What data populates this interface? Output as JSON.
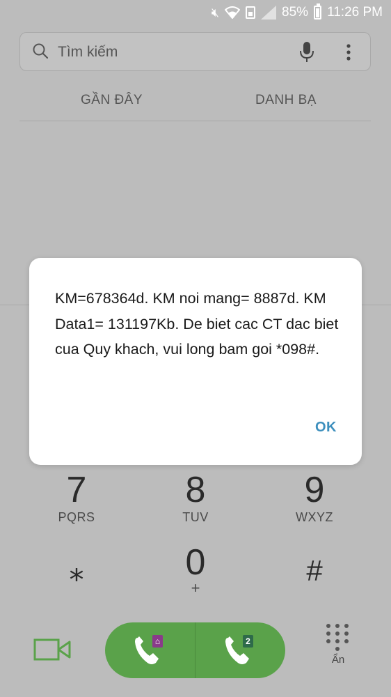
{
  "status_bar": {
    "battery": "85%",
    "time": "11:26 PM"
  },
  "search": {
    "placeholder": "Tìm kiếm"
  },
  "tabs": [
    {
      "label": "GẦN ĐÂY"
    },
    {
      "label": "DANH BẠ"
    }
  ],
  "dialog": {
    "message": "KM=678364d. KM noi mang= 8887d. KM Data1= 131197Kb. De biet cac CT dac biet cua Quy khach, vui long bam goi *098#.",
    "ok_label": "OK"
  },
  "keypad": {
    "keys": [
      {
        "digit": "7",
        "letters": "PQRS"
      },
      {
        "digit": "8",
        "letters": "TUV"
      },
      {
        "digit": "9",
        "letters": "WXYZ"
      },
      {
        "digit": "⁎",
        "letters": ""
      },
      {
        "digit": "0",
        "letters": "+"
      },
      {
        "digit": "#",
        "letters": ""
      }
    ]
  },
  "bottom_bar": {
    "sim1_badge": "",
    "sim2_badge": "2",
    "hide_label": "Ẩn"
  },
  "colors": {
    "call_green": "#5aa24a",
    "ok_blue": "#3d8fbd",
    "video_green": "#5aa24a"
  }
}
